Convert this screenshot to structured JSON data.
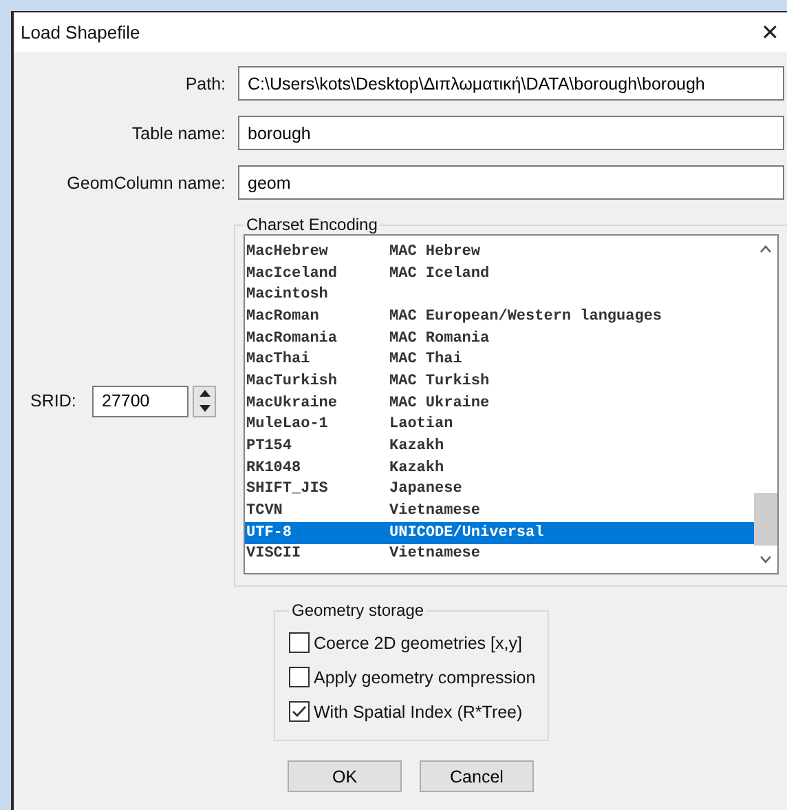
{
  "window": {
    "title": "Load Shapefile",
    "close": "✕"
  },
  "fields": [
    {
      "label": "Path:",
      "value": "C:\\Users\\kots\\Desktop\\Διπλωματική\\DATA\\borough\\borough"
    },
    {
      "label": "Table name:",
      "value": "borough"
    },
    {
      "label": "GeomColumn name:",
      "value": "geom"
    }
  ],
  "srid": {
    "label": "SRID:",
    "value": "27700"
  },
  "charset": {
    "title": "Charset Encoding",
    "rows": [
      {
        "code": "MacHebrew",
        "name": "MAC Hebrew",
        "selected": false
      },
      {
        "code": "MacIceland",
        "name": "MAC Iceland",
        "selected": false
      },
      {
        "code": "Macintosh",
        "selected": false
      },
      {
        "code": "MacRoman",
        "name": "MAC European/Western languages",
        "selected": false
      },
      {
        "code": "MacRomania",
        "name": "MAC Romania",
        "selected": false
      },
      {
        "code": "MacThai",
        "name": "MAC Thai",
        "selected": false
      },
      {
        "code": "MacTurkish",
        "name": "MAC Turkish",
        "selected": false
      },
      {
        "code": "MacUkraine",
        "name": "MAC Ukraine",
        "selected": false
      },
      {
        "code": "MuleLao-1",
        "name": "Laotian",
        "selected": false
      },
      {
        "code": "PT154",
        "name": "Kazakh",
        "selected": false
      },
      {
        "code": "RK1048",
        "name": "Kazakh",
        "selected": false
      },
      {
        "code": "SHIFT_JIS",
        "name": "Japanese",
        "selected": false
      },
      {
        "code": "TCVN",
        "name": "Vietnamese",
        "selected": false
      },
      {
        "code": "UTF-8",
        "name": "UNICODE/Universal",
        "selected": true
      },
      {
        "code": "VISCII",
        "name": "Vietnamese",
        "selected": false
      }
    ]
  },
  "geometry_storage": {
    "title": "Geometry storage",
    "options": [
      {
        "label": "Coerce 2D geometries [x,y]",
        "checked": false
      },
      {
        "label": "Apply geometry compression",
        "checked": false
      },
      {
        "label": "With Spatial Index (R*Tree)",
        "checked": true
      }
    ]
  },
  "buttons": [
    "OK",
    "Cancel"
  ]
}
